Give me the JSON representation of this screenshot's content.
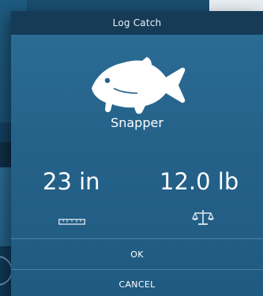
{
  "dialog": {
    "title": "Log Catch",
    "species": "Snapper",
    "length_text": "23 in",
    "weight_text": "12.0 lb",
    "ok_label": "OK",
    "cancel_label": "CANCEL"
  },
  "icons": {
    "fish": "fish-icon",
    "length": "ruler-icon",
    "weight": "scale-icon"
  },
  "colors": {
    "dialog_bg": "#2a6a92",
    "titlebar_bg": "#163b56",
    "text": "#ffffff"
  }
}
